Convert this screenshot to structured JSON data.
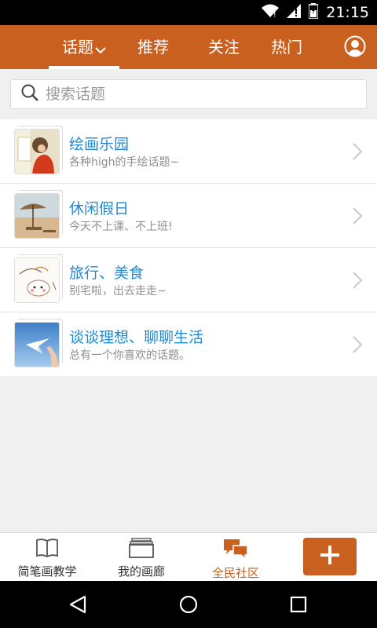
{
  "status_bar": {
    "time": "21:15",
    "icons": [
      "wifi-icon",
      "signal-icon",
      "battery-icon"
    ]
  },
  "top_nav": {
    "tabs": [
      {
        "label": "话题",
        "active": true
      },
      {
        "label": "推荐",
        "active": false
      },
      {
        "label": "关注",
        "active": false
      },
      {
        "label": "热门",
        "active": false
      }
    ],
    "profile_icon": "user-avatar-icon",
    "accent_color": "#c9601f"
  },
  "search": {
    "placeholder": "搜索话题",
    "value": ""
  },
  "topics": [
    {
      "title": "绘画乐园",
      "desc": "各种high的手绘话题~",
      "thumb": "girl-painting-image"
    },
    {
      "title": "休闲假日",
      "desc": "今天不上课、不上班!",
      "thumb": "beach-umbrella-image"
    },
    {
      "title": "旅行、美食",
      "desc": "别宅啦，出去走走~",
      "thumb": "doodle-food-image"
    },
    {
      "title": "谈谈理想、聊聊生活",
      "desc": "总有一个你喜欢的话题。",
      "thumb": "paper-plane-sky-image"
    }
  ],
  "bottom_nav": {
    "items": [
      {
        "label": "简笔画教学",
        "icon": "book-icon",
        "active": false
      },
      {
        "label": "我的画廊",
        "icon": "gallery-icon",
        "active": false
      },
      {
        "label": "全民社区",
        "icon": "chat-bubbles-icon",
        "active": true
      }
    ],
    "add_icon": "plus-icon"
  },
  "android_nav": {
    "buttons": [
      "back-icon",
      "home-icon",
      "recent-apps-icon"
    ]
  },
  "colors": {
    "accent": "#c9601f",
    "link_blue": "#1e8ad6",
    "desc_gray": "#8e8e8e"
  }
}
